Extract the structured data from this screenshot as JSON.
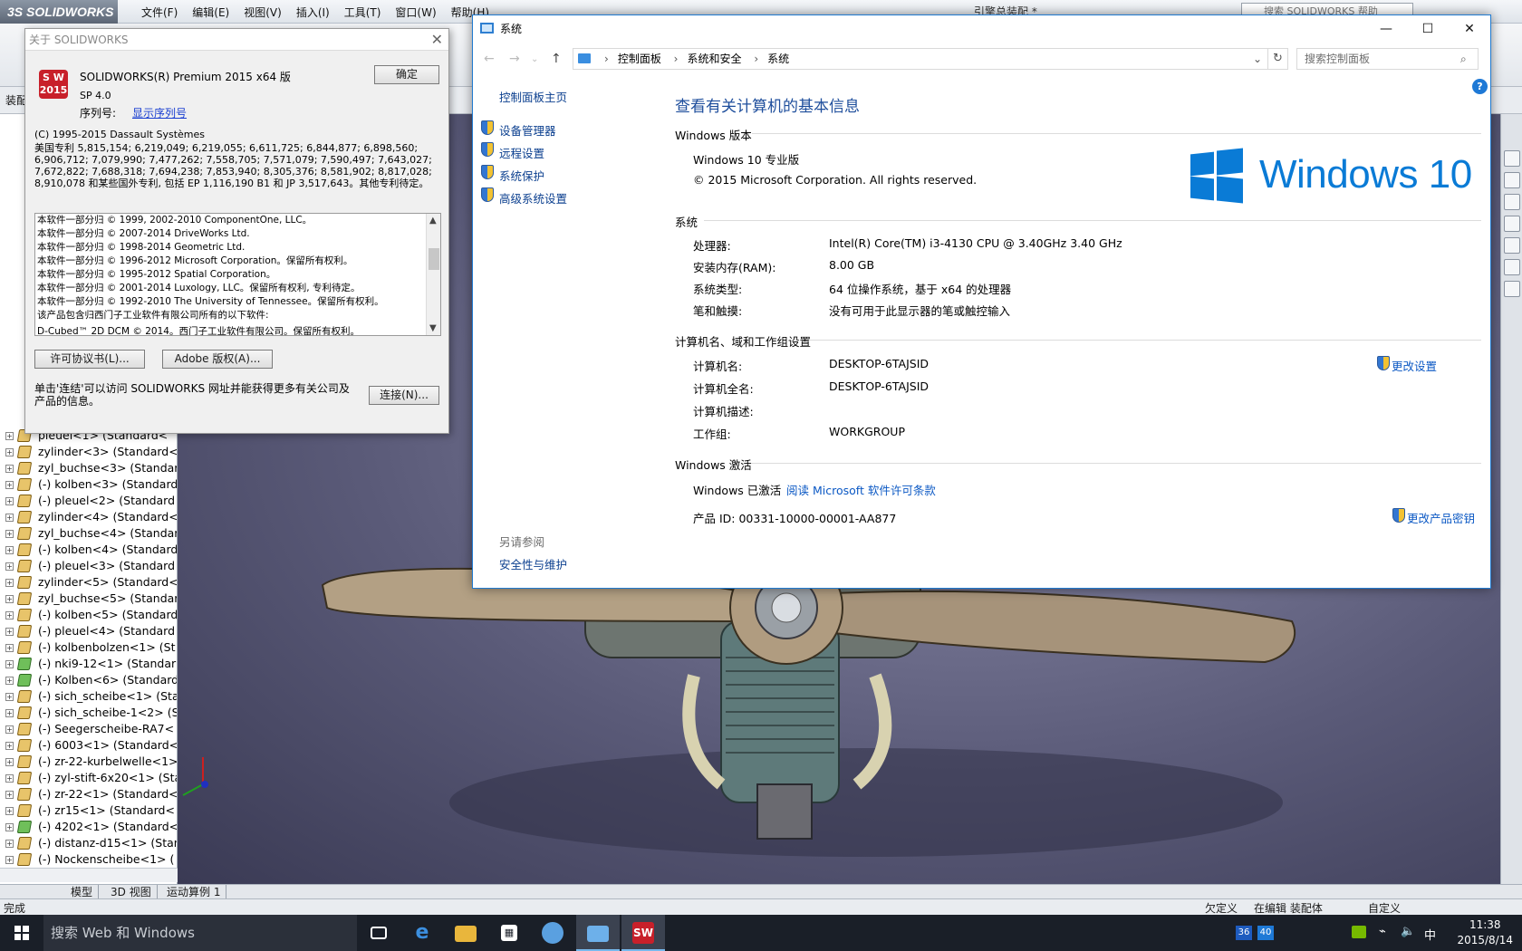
{
  "solidworks": {
    "app_name": "SOLIDWORKS",
    "menu": [
      "文件(F)",
      "编辑(E)",
      "视图(V)",
      "插入(I)",
      "工具(T)",
      "窗口(W)",
      "帮助(H)"
    ],
    "doc_title": "引擎总装配 *",
    "search_placeholder": "搜索 SOLIDWORKS 帮助",
    "tab_assembly": "装配",
    "tree_items": [
      "pleuel<1> (Standard<",
      "zylinder<3> (Standard<",
      "zyl_buchse<3> (Standar",
      "(-) kolben<3> (Standard",
      "(-) pleuel<2> (Standard",
      "zylinder<4> (Standard<",
      "zyl_buchse<4> (Standar",
      "(-) kolben<4> (Standard",
      "(-) pleuel<3> (Standard",
      "zylinder<5> (Standard<",
      "zyl_buchse<5> (Standar",
      "(-) kolben<5> (Standard",
      "(-) pleuel<4> (Standard",
      "(-) kolbenbolzen<1> (St",
      "(-) nki9-12<1> (Standar",
      "(-) Kolben<6> (Standard",
      "(-) sich_scheibe<1> (Sta",
      "(-) sich_scheibe-1<2> (S",
      "(-) Seegerscheibe-RA7<",
      "(-) 6003<1> (Standard<",
      "(-) zr-22-kurbelwelle<1>",
      "(-) zyl-stift-6x20<1> (Sta",
      "(-) zr-22<1> (Standard<",
      "(-) zr15<1> (Standard<",
      "(-) 4202<1> (Standard<",
      "(-) distanz-d15<1> (Stan",
      "(-) Nockenscheibe<1> ("
    ],
    "bottom_tabs": [
      "模型",
      "3D 视图",
      "运动算例 1"
    ],
    "status_left": "完成",
    "status_underdefined": "欠定义",
    "status_editing": "在编辑 装配体",
    "status_custom": "自定义"
  },
  "about_dialog": {
    "title": "关于 SOLIDWORKS",
    "product": "SOLIDWORKS(R) Premium 2015 x64 版",
    "sp": "SP 4.0",
    "serial_label": "序列号:",
    "serial_link": "显示序列号",
    "ok_button": "确定",
    "copyright": "(C) 1995-2015 Dassault Systèmes",
    "patents": "美国专利 5,815,154; 6,219,049; 6,219,055; 6,611,725; 6,844,877; 6,898,560; 6,906,712; 7,079,990; 7,477,262; 7,558,705; 7,571,079; 7,590,497; 7,643,027; 7,672,822; 7,688,318; 7,694,238; 7,853,940; 8,305,376; 8,581,902; 8,817,028; 8,910,078 和某些国外专利, 包括 EP 1,116,190 B1 和 JP 3,517,643。其他专利待定。",
    "credits": [
      "本软件一部分归  © 1999, 2002-2010 ComponentOne, LLC。",
      "本软件一部分归  © 2007-2014 DriveWorks Ltd.",
      "本软件一部分归  © 1998-2014 Geometric Ltd.",
      "本软件一部分归  © 1996-2012 Microsoft Corporation。保留所有权利。",
      "本软件一部分归  © 1995-2012 Spatial Corporation。",
      "本软件一部分归  © 2001-2014 Luxology, LLC。保留所有权利, 专利待定。",
      "本软件一部分归  © 1992-2010 The University of Tennessee。保留所有权利。",
      "该产品包含归西门子工业软件有限公司所有的以下软件:",
      "  D-Cubed™ 2D DCM © 2014。西门子工业软件有限公司。保留所有权利。"
    ],
    "license_button": "许可协议书(L)...",
    "adobe_button": "Adobe 版权(A)...",
    "connect_text": "单击'连结'可以访问 SOLIDWORKS 网址并能获得更多有关公司及产品的信息。",
    "connect_button": "连接(N)..."
  },
  "system_window": {
    "title": "系统",
    "breadcrumb": [
      "控制面板",
      "系统和安全",
      "系统"
    ],
    "search_placeholder": "搜索控制面板",
    "left_nav": {
      "home": "控制面板主页",
      "links": [
        "设备管理器",
        "远程设置",
        "系统保护",
        "高级系统设置"
      ],
      "see_also_title": "另请参阅",
      "see_also_link": "安全性与维护"
    },
    "heading": "查看有关计算机的基本信息",
    "edition_section": "Windows 版本",
    "edition": "Windows 10 专业版",
    "edition_copyright": "© 2015 Microsoft Corporation. All rights reserved.",
    "logo_text": "Windows 10",
    "system_section": "系统",
    "system": [
      {
        "key": "处理器:",
        "value": "Intel(R) Core(TM) i3-4130 CPU @ 3.40GHz   3.40 GHz"
      },
      {
        "key": "安装内存(RAM):",
        "value": "8.00 GB"
      },
      {
        "key": "系统类型:",
        "value": "64 位操作系统，基于 x64 的处理器"
      },
      {
        "key": "笔和触摸:",
        "value": "没有可用于此显示器的笔或触控输入"
      }
    ],
    "computer_section": "计算机名、域和工作组设置",
    "computer": [
      {
        "key": "计算机名:",
        "value": "DESKTOP-6TAJSID"
      },
      {
        "key": "计算机全名:",
        "value": "DESKTOP-6TAJSID"
      },
      {
        "key": "计算机描述:",
        "value": ""
      },
      {
        "key": "工作组:",
        "value": "WORKGROUP"
      }
    ],
    "change_settings": "更改设置",
    "activation_section": "Windows 激活",
    "activated": "Windows 已激活",
    "license_link": "阅读 Microsoft 软件许可条款",
    "product_id": "产品 ID: 00331-10000-00001-AA877",
    "change_key": "更改产品密钥"
  },
  "taskbar": {
    "search_placeholder": "搜索 Web 和 Windows",
    "tray_badges": [
      "36",
      "40"
    ],
    "ime": "中",
    "time": "11:38",
    "date": "2015/8/14"
  },
  "colors": {
    "accent": "#0a7bd6",
    "link": "#0b58c4",
    "taskbar": "#1a1f28"
  }
}
